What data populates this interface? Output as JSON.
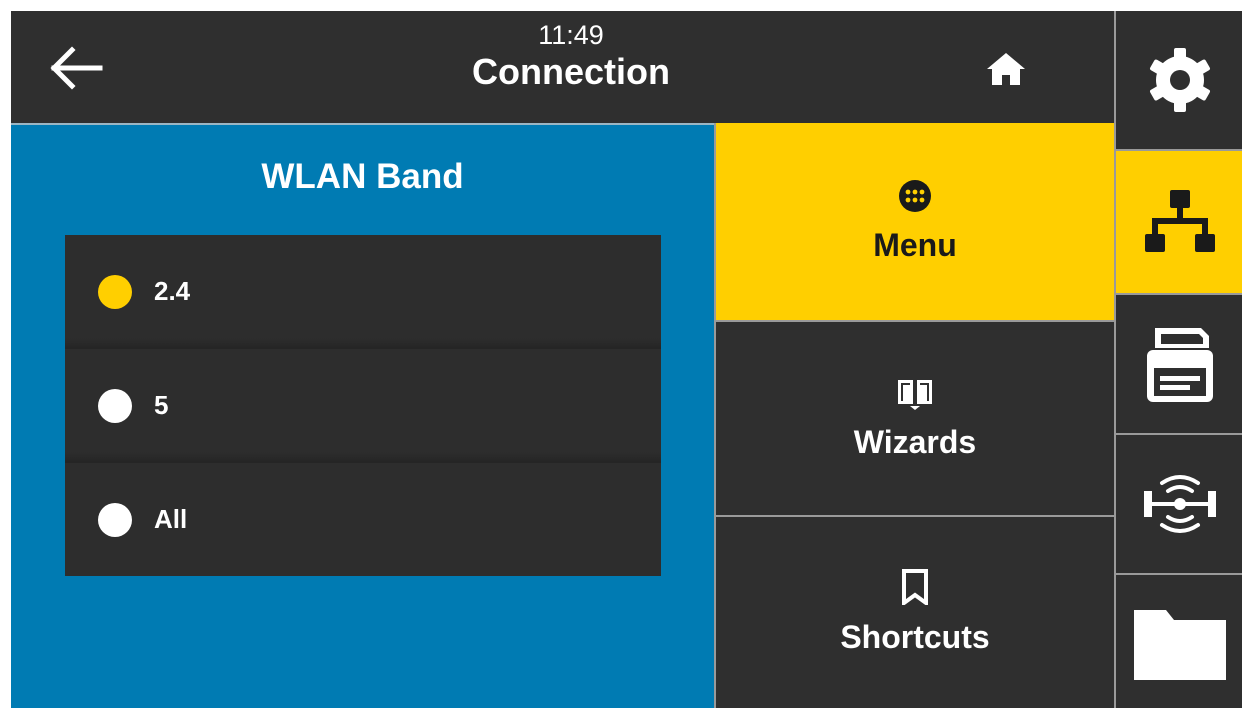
{
  "header": {
    "time": "11:49",
    "title": "Connection",
    "back_icon": "arrow-left-icon",
    "home_icon": "home-icon"
  },
  "panel": {
    "title": "WLAN Band",
    "options": [
      {
        "label": "2.4",
        "selected": true
      },
      {
        "label": "5",
        "selected": false
      },
      {
        "label": "All",
        "selected": false
      }
    ]
  },
  "menu": {
    "items": [
      {
        "label": "Menu",
        "icon": "grid-dots-icon",
        "active": true
      },
      {
        "label": "Wizards",
        "icon": "book-icon",
        "active": false
      },
      {
        "label": "Shortcuts",
        "icon": "bookmark-icon",
        "active": false
      }
    ]
  },
  "rail": {
    "items": [
      {
        "icon": "gear-icon",
        "active": false
      },
      {
        "icon": "network-icon",
        "active": true
      },
      {
        "icon": "printer-icon",
        "active": false
      },
      {
        "icon": "rfid-icon",
        "active": false
      },
      {
        "icon": "folder-icon",
        "active": false
      }
    ]
  },
  "colors": {
    "accent": "#ffcf00",
    "panel_blue": "#007bb3",
    "background": "#2f2f2f"
  }
}
